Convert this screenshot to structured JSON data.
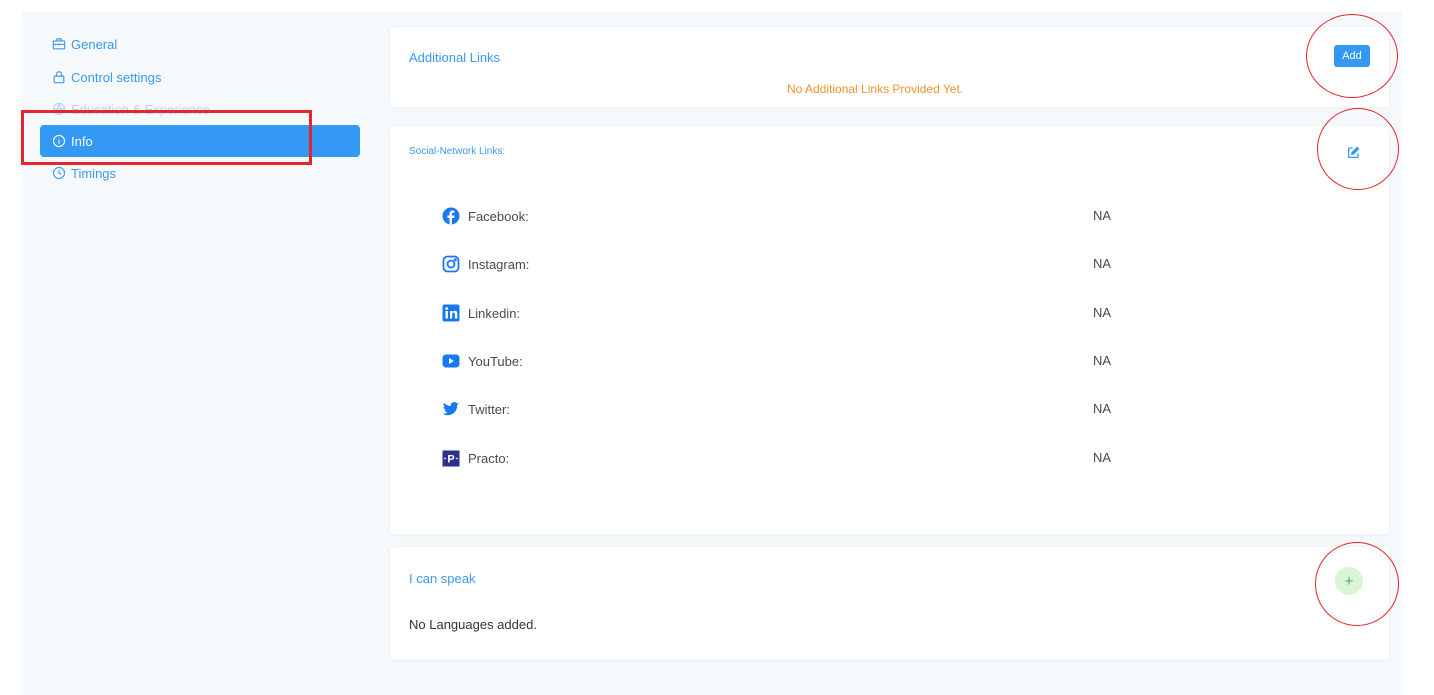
{
  "sidebar": {
    "items": [
      {
        "label": "General",
        "icon": "briefcase-icon",
        "state": "normal"
      },
      {
        "label": "Control settings",
        "icon": "lock-icon",
        "state": "normal"
      },
      {
        "label": "Education & Experience",
        "icon": "globe-icon",
        "state": "faded"
      },
      {
        "label": "Info",
        "icon": "info-icon",
        "state": "active"
      },
      {
        "label": "Timings",
        "icon": "clock-icon",
        "state": "normal"
      }
    ]
  },
  "additional_links": {
    "title": "Additional Links",
    "add_label": "Add",
    "empty_message": "No Additional Links Provided Yet."
  },
  "social_links": {
    "title": "Social-Network Links:",
    "edit_icon": "edit-icon",
    "rows": [
      {
        "label": "Facebook:",
        "value": "NA",
        "icon": "facebook-icon",
        "color": "#1877f2"
      },
      {
        "label": "Instagram:",
        "value": "NA",
        "icon": "instagram-icon",
        "color": "#1877f2"
      },
      {
        "label": "Linkedin:",
        "value": "NA",
        "icon": "linkedin-icon",
        "color": "#1877f2"
      },
      {
        "label": "YouTube:",
        "value": "NA",
        "icon": "youtube-icon",
        "color": "#1877f2"
      },
      {
        "label": "Twitter:",
        "value": "NA",
        "icon": "twitter-icon",
        "color": "#1877f2"
      },
      {
        "label": "Practo:",
        "value": "NA",
        "icon": "practo-icon",
        "color": "#28328c"
      }
    ]
  },
  "languages": {
    "title": "I can speak",
    "add_icon": "plus-icon",
    "add_symbol": "+",
    "empty_message": "No Languages added."
  },
  "colors": {
    "accent": "#3399f5",
    "warning_text": "#f0932b",
    "annotation": "#e5262b",
    "success_bg": "#d8f5d5"
  }
}
